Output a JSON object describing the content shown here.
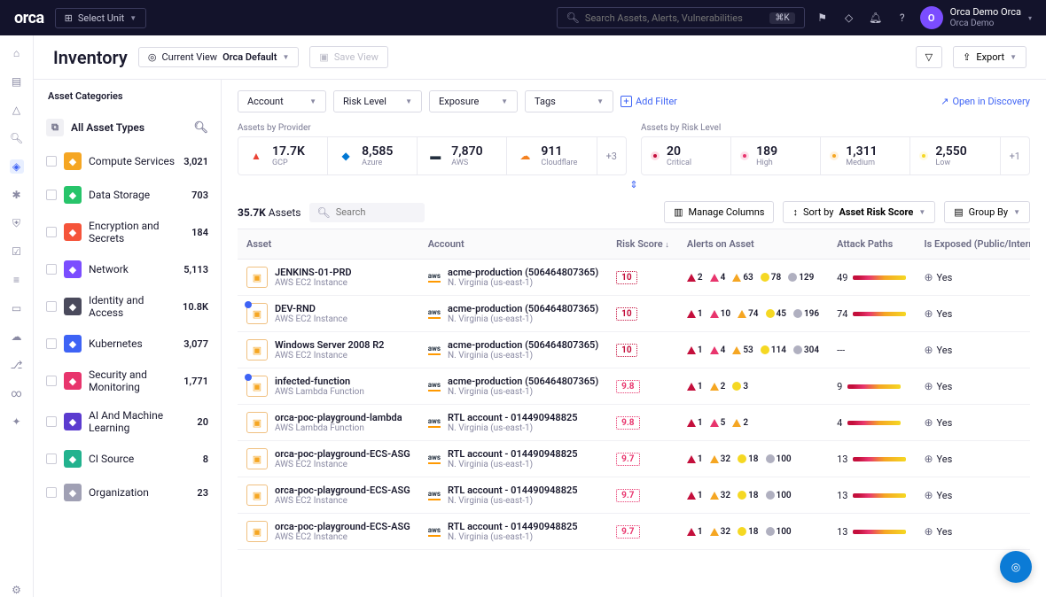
{
  "topbar": {
    "logo": "orca",
    "unit_btn": "Select Unit",
    "search_placeholder": "Search Assets, Alerts, Vulnerabilities",
    "kbd": "⌘K",
    "user_name": "Orca Demo Orca",
    "user_sub": "Orca Demo",
    "avatar_letter": "O"
  },
  "page": {
    "title": "Inventory",
    "view_prefix": "Current View",
    "view_name": "Orca Default",
    "save_view": "Save View",
    "export": "Export"
  },
  "sidebar": {
    "title": "Asset Categories",
    "all": "All Asset Types",
    "cats": [
      {
        "label": "Compute Services",
        "count": "3,021",
        "color": "#f5a623"
      },
      {
        "label": "Data Storage",
        "count": "703",
        "color": "#27c46a"
      },
      {
        "label": "Encryption and Secrets",
        "count": "184",
        "color": "#f5543a"
      },
      {
        "label": "Network",
        "count": "5,113",
        "color": "#7b4dff"
      },
      {
        "label": "Identity and Access",
        "count": "10.8K",
        "color": "#4a4a5c"
      },
      {
        "label": "Kubernetes",
        "count": "3,077",
        "color": "#3e63f5"
      },
      {
        "label": "Security and Monitoring",
        "count": "1,771",
        "color": "#e8356d"
      },
      {
        "label": "AI And Machine Learning",
        "count": "20",
        "color": "#5b3bcf"
      },
      {
        "label": "CI Source",
        "count": "8",
        "color": "#22b28e"
      },
      {
        "label": "Organization",
        "count": "23",
        "color": "#a0a0b4"
      }
    ]
  },
  "filters": {
    "items": [
      "Account",
      "Risk Level",
      "Exposure",
      "Tags"
    ],
    "add": "Add Filter",
    "open_discovery": "Open in Discovery"
  },
  "stats": {
    "providers_label": "Assets by Provider",
    "risk_label": "Assets by Risk Level",
    "providers": [
      {
        "v": "17.7K",
        "lbl": "GCP"
      },
      {
        "v": "8,585",
        "lbl": "Azure"
      },
      {
        "v": "7,870",
        "lbl": "AWS"
      },
      {
        "v": "911",
        "lbl": "Cloudflare"
      }
    ],
    "providers_more": "+3",
    "risks": [
      {
        "v": "20",
        "lbl": "Critical",
        "cls": "crit"
      },
      {
        "v": "189",
        "lbl": "High",
        "cls": "high"
      },
      {
        "v": "1,311",
        "lbl": "Medium",
        "cls": "med"
      },
      {
        "v": "2,550",
        "lbl": "Low",
        "cls": "low"
      }
    ],
    "risks_more": "+1"
  },
  "table": {
    "total": "35.7K",
    "total_label": "Assets",
    "search_placeholder": "Search",
    "manage_cols": "Manage Columns",
    "sort_prefix": "Sort by",
    "sort_value": "Asset Risk Score",
    "group_by": "Group By",
    "columns": [
      "Asset",
      "Account",
      "Risk Score",
      "Alerts on Asset",
      "Attack Paths",
      "Is Exposed (Public/Internet)"
    ],
    "rows": [
      {
        "name": "JENKINS-01-PRD",
        "sub": "AWS EC2 Instance",
        "acct": "acme-production (506464807365)",
        "region": "N. Virginia (us-east-1)",
        "score": "10",
        "scls": "s10",
        "alerts": {
          "crit": "2",
          "high": "4",
          "med": "63",
          "low": "78",
          "info": "129"
        },
        "paths": "49",
        "exposed": "Yes",
        "mark": false
      },
      {
        "name": "DEV-RND",
        "sub": "AWS EC2 Instance",
        "acct": "acme-production (506464807365)",
        "region": "N. Virginia (us-east-1)",
        "score": "10",
        "scls": "s10",
        "alerts": {
          "crit": "1",
          "high": "10",
          "med": "74",
          "low": "45",
          "info": "196"
        },
        "paths": "74",
        "exposed": "Yes",
        "mark": true
      },
      {
        "name": "Windows Server 2008 R2",
        "sub": "AWS EC2 Instance",
        "acct": "acme-production (506464807365)",
        "region": "N. Virginia (us-east-1)",
        "score": "10",
        "scls": "s10",
        "alerts": {
          "crit": "1",
          "high": "4",
          "med": "53",
          "low": "114",
          "info": "304"
        },
        "paths": "---",
        "exposed": "Yes",
        "mark": false
      },
      {
        "name": "infected-function",
        "sub": "AWS Lambda Function",
        "acct": "acme-production (506464807365)",
        "region": "N. Virginia (us-east-1)",
        "score": "9.8",
        "scls": "s9",
        "alerts": {
          "crit": "1",
          "high": "",
          "med": "2",
          "low": "3",
          "info": ""
        },
        "paths": "9",
        "exposed": "Yes",
        "mark": true
      },
      {
        "name": "orca-poc-playground-lambda",
        "sub": "AWS Lambda Function",
        "acct": "RTL account - 014490948825",
        "region": "N. Virginia (us-east-1)",
        "score": "9.8",
        "scls": "s9",
        "alerts": {
          "crit": "1",
          "high": "5",
          "med": "2",
          "low": "",
          "info": ""
        },
        "paths": "4",
        "exposed": "Yes",
        "mark": false
      },
      {
        "name": "orca-poc-playground-ECS-ASG",
        "sub": "AWS EC2 Instance",
        "acct": "RTL account - 014490948825",
        "region": "N. Virginia (us-east-1)",
        "score": "9.7",
        "scls": "s9",
        "alerts": {
          "crit": "1",
          "high": "",
          "med": "32",
          "low": "18",
          "info": "100"
        },
        "paths": "13",
        "exposed": "Yes",
        "mark": false
      },
      {
        "name": "orca-poc-playground-ECS-ASG",
        "sub": "AWS EC2 Instance",
        "acct": "RTL account - 014490948825",
        "region": "N. Virginia (us-east-1)",
        "score": "9.7",
        "scls": "s9",
        "alerts": {
          "crit": "1",
          "high": "",
          "med": "32",
          "low": "18",
          "info": "100"
        },
        "paths": "13",
        "exposed": "Yes",
        "mark": false
      },
      {
        "name": "orca-poc-playground-ECS-ASG",
        "sub": "AWS EC2 Instance",
        "acct": "RTL account - 014490948825",
        "region": "N. Virginia (us-east-1)",
        "score": "9.7",
        "scls": "s9",
        "alerts": {
          "crit": "1",
          "high": "",
          "med": "32",
          "low": "18",
          "info": "100"
        },
        "paths": "13",
        "exposed": "Yes",
        "mark": false
      }
    ]
  }
}
